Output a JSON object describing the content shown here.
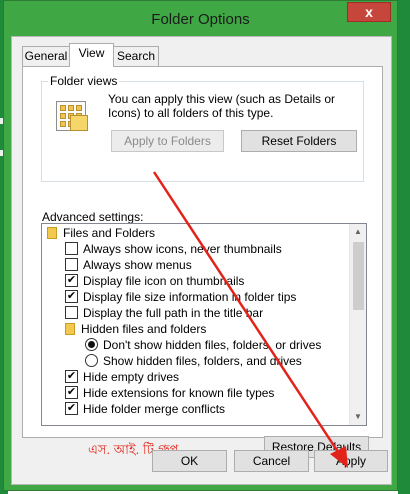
{
  "window": {
    "title": "Folder Options",
    "close_glyph": "x"
  },
  "tabs": [
    {
      "label": "General"
    },
    {
      "label": "View"
    },
    {
      "label": "Search"
    }
  ],
  "folder_views": {
    "legend": "Folder views",
    "description": "You can apply this view (such as Details or Icons) to all folders of this type.",
    "apply_label": "Apply to Folders",
    "reset_label": "Reset Folders"
  },
  "advanced": {
    "label": "Advanced settings:",
    "items": [
      {
        "label": "Files and Folders",
        "kind": "folder"
      },
      {
        "label": "Always show icons, never thumbnails",
        "kind": "checkbox",
        "checked": false
      },
      {
        "label": "Always show menus",
        "kind": "checkbox",
        "checked": false
      },
      {
        "label": "Display file icon on thumbnails",
        "kind": "checkbox",
        "checked": true
      },
      {
        "label": "Display file size information in folder tips",
        "kind": "checkbox",
        "checked": true
      },
      {
        "label": "Display the full path in the title bar",
        "kind": "checkbox",
        "checked": false
      },
      {
        "label": "Hidden files and folders",
        "kind": "folder"
      },
      {
        "label": "Don't show hidden files, folders, or drives",
        "kind": "radio",
        "checked": true
      },
      {
        "label": "Show hidden files, folders, and drives",
        "kind": "radio",
        "checked": false
      },
      {
        "label": "Hide empty drives",
        "kind": "checkbox",
        "checked": true
      },
      {
        "label": "Hide extensions for known file types",
        "kind": "checkbox",
        "checked": true
      },
      {
        "label": "Hide folder merge conflicts",
        "kind": "checkbox",
        "checked": true
      }
    ]
  },
  "restore_label": "Restore Defaults",
  "watermark": "এস. আই. টি গ্রুপ",
  "footer": {
    "ok_label": "OK",
    "cancel_label": "Cancel",
    "apply_label": "Apply"
  },
  "colors": {
    "annotation_arrow": "#e2231a",
    "window_frame": "#3fa844"
  },
  "icons": {
    "check": "✔",
    "scroll_up": "▲",
    "scroll_down": "▼"
  }
}
